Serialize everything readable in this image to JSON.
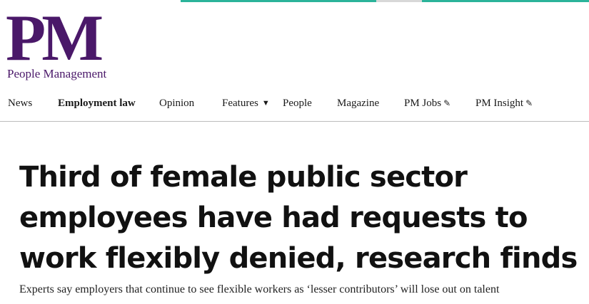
{
  "brand": {
    "logo_mark": "PM",
    "logo_sub": "People Management",
    "accent_color": "#4a1869",
    "strip_color": "#2bb39a"
  },
  "nav": {
    "items": [
      {
        "label": "News",
        "icon": ""
      },
      {
        "label": "Employment law",
        "icon": "",
        "active": true
      },
      {
        "label": "Opinion",
        "icon": ""
      },
      {
        "label": "Features",
        "icon": "caret-down-icon"
      },
      {
        "label": "People",
        "icon": ""
      },
      {
        "label": "Magazine",
        "icon": ""
      },
      {
        "label": "PM Jobs",
        "icon": "external-pen-icon"
      },
      {
        "label": "PM Insight",
        "icon": "external-pen-icon"
      }
    ]
  },
  "article": {
    "headline": "Third of female public sector employees have had requests to work flexibly denied, research finds",
    "standfirst": "Experts say employers that continue to see flexible workers as ‘lesser contributors’ will lose out on talent"
  }
}
